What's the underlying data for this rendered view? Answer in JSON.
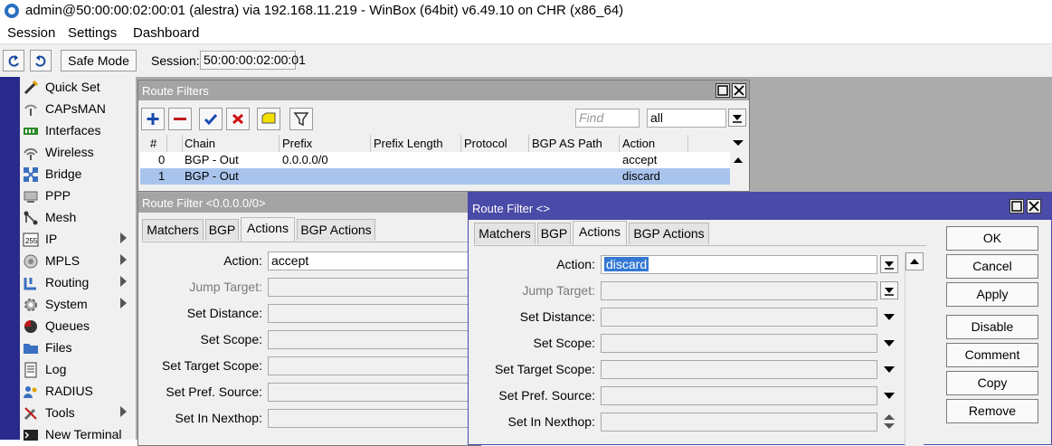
{
  "window": {
    "title": "admin@50:00:00:02:00:01 (alestra) via 192.168.11.219 - WinBox (64bit) v6.49.10 on CHR (x86_64)"
  },
  "menu": [
    "Session",
    "Settings",
    "Dashboard"
  ],
  "toolbar": {
    "safe_mode": "Safe Mode",
    "session_label": "Session:",
    "session_value": "50:00:00:02:00:01"
  },
  "sidebar": [
    {
      "label": "Quick Set",
      "icon": "wand-icon",
      "sub": false
    },
    {
      "label": "CAPsMAN",
      "icon": "wifi-antenna-icon",
      "sub": false
    },
    {
      "label": "Interfaces",
      "icon": "network-card-icon",
      "sub": false
    },
    {
      "label": "Wireless",
      "icon": "wireless-icon",
      "sub": false
    },
    {
      "label": "Bridge",
      "icon": "bridge-icon",
      "sub": false
    },
    {
      "label": "PPP",
      "icon": "ppp-icon",
      "sub": false
    },
    {
      "label": "Mesh",
      "icon": "mesh-icon",
      "sub": false
    },
    {
      "label": "IP",
      "icon": "ip-icon",
      "sub": true
    },
    {
      "label": "MPLS",
      "icon": "mpls-icon",
      "sub": true
    },
    {
      "label": "Routing",
      "icon": "routing-icon",
      "sub": true
    },
    {
      "label": "System",
      "icon": "gear-icon",
      "sub": true
    },
    {
      "label": "Queues",
      "icon": "queues-icon",
      "sub": false
    },
    {
      "label": "Files",
      "icon": "folder-icon",
      "sub": false
    },
    {
      "label": "Log",
      "icon": "log-icon",
      "sub": false
    },
    {
      "label": "RADIUS",
      "icon": "users-icon",
      "sub": false
    },
    {
      "label": "Tools",
      "icon": "tools-icon",
      "sub": true
    },
    {
      "label": "New Terminal",
      "icon": "terminal-icon",
      "sub": false
    }
  ],
  "route_filters": {
    "title": "Route Filters",
    "find_placeholder": "Find",
    "filter_value": "all",
    "columns": [
      "#",
      "Chain",
      "Prefix",
      "Prefix Length",
      "Protocol",
      "BGP AS Path",
      "Action"
    ],
    "rows": [
      {
        "num": "0",
        "chain": "BGP - Out",
        "prefix": "0.0.0.0/0",
        "prefix_length": "",
        "protocol": "",
        "bgp_as_path": "",
        "action": "accept"
      },
      {
        "num": "1",
        "chain": "BGP - Out",
        "prefix": "",
        "prefix_length": "",
        "protocol": "",
        "bgp_as_path": "",
        "action": "discard"
      }
    ]
  },
  "filter_bg": {
    "title": "Route Filter <0.0.0.0/0>",
    "tabs": [
      "Matchers",
      "BGP",
      "Actions",
      "BGP Actions"
    ],
    "fields": [
      {
        "label": "Action:",
        "value": "accept"
      },
      {
        "label": "Jump Target:",
        "value": ""
      },
      {
        "label": "Set Distance:",
        "value": ""
      },
      {
        "label": "Set Scope:",
        "value": ""
      },
      {
        "label": "Set Target Scope:",
        "value": ""
      },
      {
        "label": "Set Pref. Source:",
        "value": ""
      },
      {
        "label": "Set In Nexthop:",
        "value": ""
      }
    ]
  },
  "filter_fg": {
    "title": "Route Filter <>",
    "tabs": [
      "Matchers",
      "BGP",
      "Actions",
      "BGP Actions"
    ],
    "fields": [
      {
        "label": "Action:",
        "value": "discard"
      },
      {
        "label": "Jump Target:",
        "value": ""
      },
      {
        "label": "Set Distance:",
        "value": ""
      },
      {
        "label": "Set Scope:",
        "value": ""
      },
      {
        "label": "Set Target Scope:",
        "value": ""
      },
      {
        "label": "Set Pref. Source:",
        "value": ""
      },
      {
        "label": "Set In Nexthop:",
        "value": ""
      }
    ],
    "buttons": [
      "OK",
      "Cancel",
      "Apply",
      "Disable",
      "Comment",
      "Copy",
      "Remove"
    ]
  },
  "colors": {
    "active_title": "#4a4aa8",
    "inactive_title": "#a4a4a4",
    "selection": "#a8c4ec",
    "left_strip": "#2a2a8c"
  }
}
